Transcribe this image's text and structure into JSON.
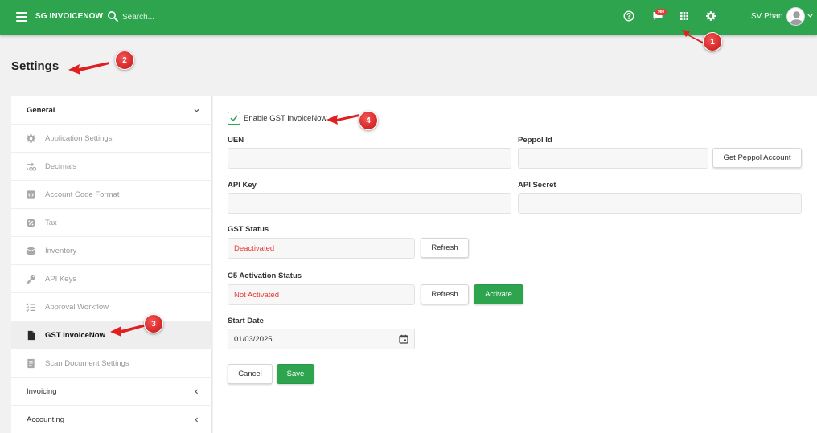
{
  "app": {
    "brand": "SG INVOICENOW",
    "search_placeholder": "Search...",
    "notification_count": "980",
    "username": "SV Phan",
    "icons": [
      "menu-icon",
      "search-icon",
      "help-icon",
      "notification-icon",
      "apps-grid-icon",
      "gear-icon",
      "avatar-icon"
    ]
  },
  "page": {
    "title": "Settings"
  },
  "sidebar": {
    "general": "General",
    "items": [
      {
        "label": "Application Settings",
        "icon": "gear-icon"
      },
      {
        "label": "Decimals",
        "icon": "decimals-icon"
      },
      {
        "label": "Account Code Format",
        "icon": "code-format-icon"
      },
      {
        "label": "Tax",
        "icon": "percent-icon"
      },
      {
        "label": "Inventory",
        "icon": "box-icon"
      },
      {
        "label": "API Keys",
        "icon": "key-icon"
      },
      {
        "label": "Approval Workflow",
        "icon": "checklist-icon"
      },
      {
        "label": "GST InvoiceNow",
        "icon": "document-icon"
      },
      {
        "label": "Scan Document Settings",
        "icon": "scan-document-icon"
      }
    ],
    "invoicing": "Invoicing",
    "accounting": "Accounting"
  },
  "form": {
    "enable_label": "Enable GST InvoiceNow",
    "enable_checked": true,
    "uen_label": "UEN",
    "uen_value": "",
    "peppol_label": "Peppol Id",
    "peppol_value": "",
    "get_peppol_button": "Get Peppol Account",
    "api_key_label": "API Key",
    "api_key_value": "",
    "api_secret_label": "API Secret",
    "api_secret_value": "",
    "gst_status_label": "GST Status",
    "gst_status_value": "Deactivated",
    "refresh_label": "Refresh",
    "c5_label": "C5 Activation Status",
    "c5_value": "Not Activated",
    "activate_label": "Activate",
    "start_date_label": "Start Date",
    "start_date_value": "01/03/2025",
    "cancel_label": "Cancel",
    "save_label": "Save"
  },
  "annotations": [
    "1",
    "2",
    "3",
    "4"
  ],
  "colors": {
    "primary": "#2ea44f",
    "status_red": "#e53935",
    "annotation_red": "#d81e1e"
  }
}
